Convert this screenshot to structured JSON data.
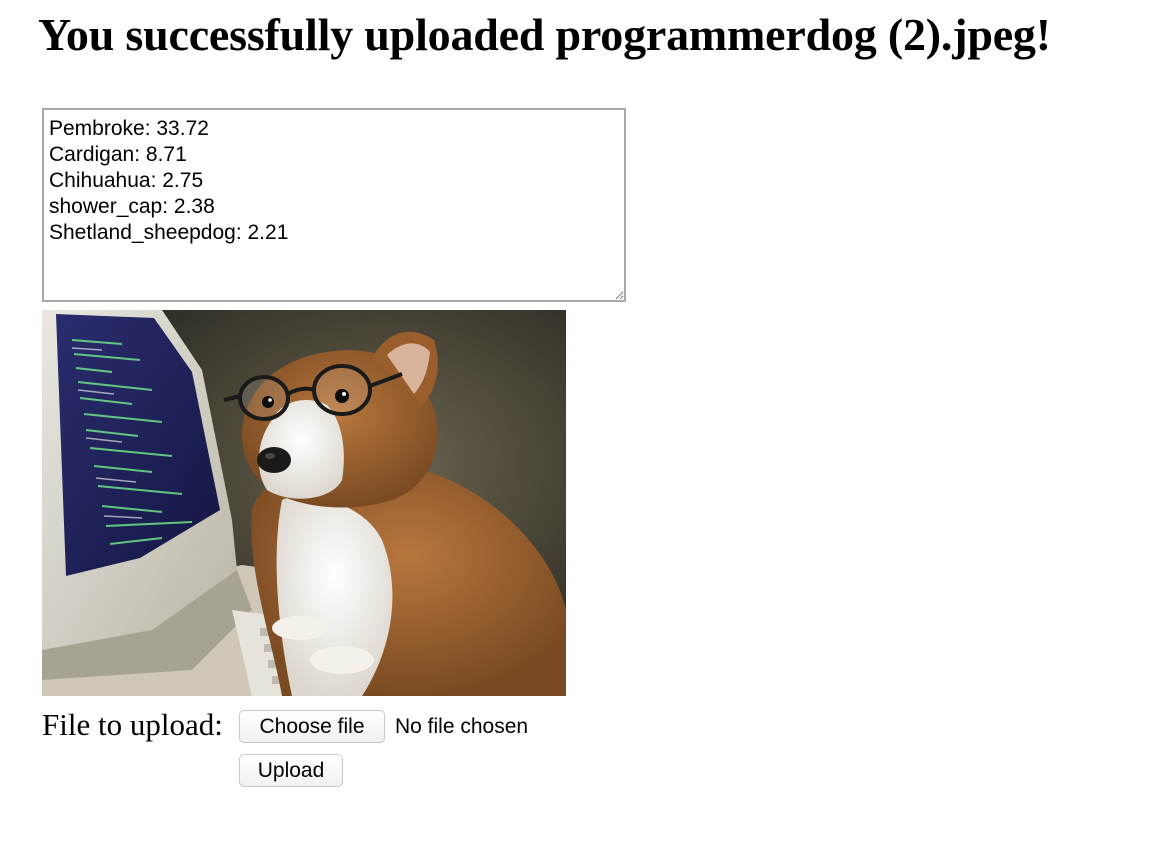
{
  "page": {
    "title": "You successfully uploaded programmerdog (2).jpeg!"
  },
  "predictions": {
    "text": "Pembroke: 33.72\nCardigan: 8.71\nChihuahua: 2.75\nshower_cap: 2.38\nShetland_sheepdog: 2.21",
    "items": [
      {
        "label": "Pembroke",
        "score": 33.72
      },
      {
        "label": "Cardigan",
        "score": 8.71
      },
      {
        "label": "Chihuahua",
        "score": 2.75
      },
      {
        "label": "shower_cap",
        "score": 2.38
      },
      {
        "label": "Shetland_sheepdog",
        "score": 2.21
      }
    ]
  },
  "image": {
    "subject": "corgi wearing glasses at a computer"
  },
  "form": {
    "file_label": "File to upload:",
    "choose_file_label": "Choose file",
    "file_status": "No file chosen",
    "upload_label": "Upload"
  },
  "colors": {
    "textarea_border": "#a9a9a9",
    "button_border": "#c8c8c8",
    "background": "#ffffff"
  }
}
